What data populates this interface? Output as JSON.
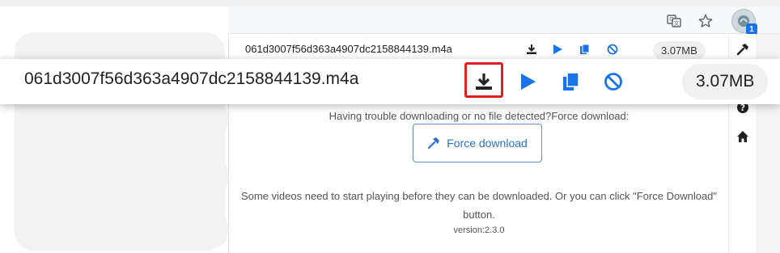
{
  "file": {
    "name": "061d3007f56d363a4907dc2158844139.m4a",
    "size": "3.07MB"
  },
  "toolbar": {
    "extension_badge": "1"
  },
  "popup": {
    "trouble_text": "Having trouble downloading or no file detected?Force download:",
    "force_button_label": "Force download",
    "note_text": "Some videos need to start playing before they can be downloaded. Or you can click \"Force Download\" button.",
    "version_text": "version:2.3.0"
  },
  "icons": [
    "translate-icon",
    "star-icon",
    "extension-icon",
    "download-icon",
    "play-icon",
    "copy-icon",
    "block-icon",
    "hammer-icon",
    "help-icon",
    "home-icon"
  ],
  "colors": {
    "accent_blue": "#1a73e8",
    "highlight_red": "#e02020",
    "force_button_border": "#5b8fd6"
  }
}
